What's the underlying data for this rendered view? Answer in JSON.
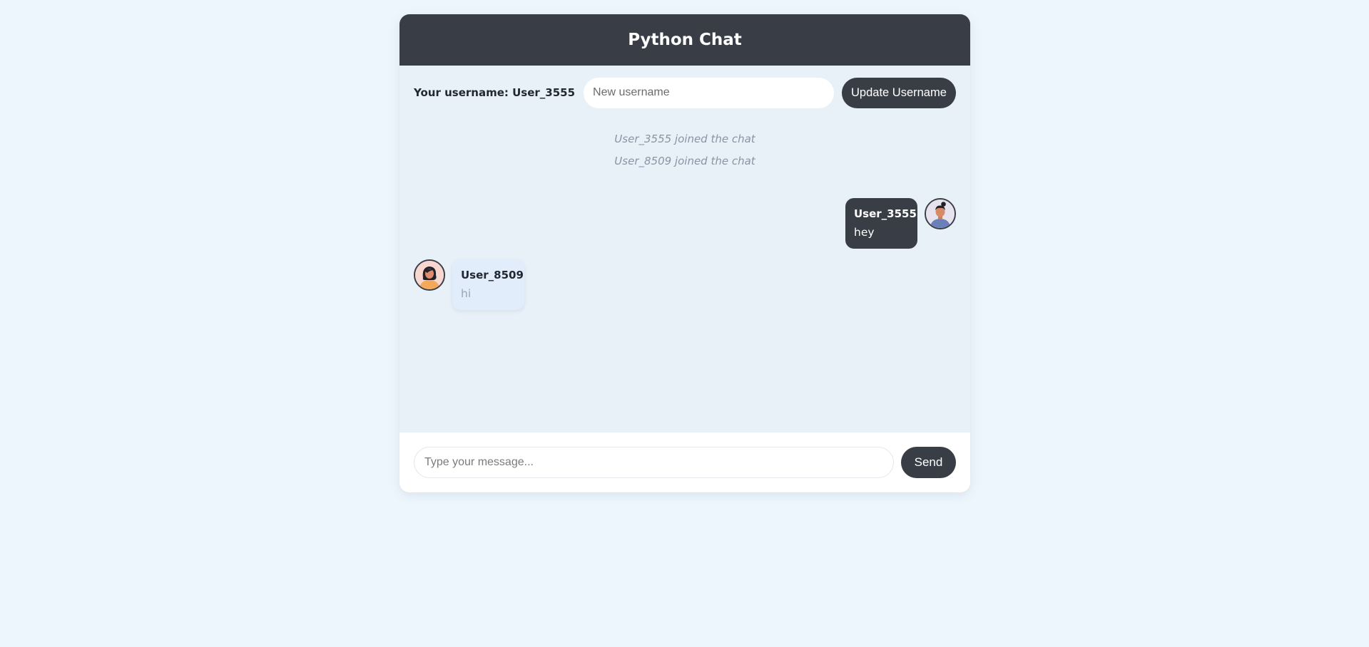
{
  "header": {
    "title": "Python Chat"
  },
  "username_bar": {
    "label": "Your username: User_3555",
    "input_placeholder": "New username",
    "input_value": "",
    "update_button": "Update Username"
  },
  "system_messages": [
    "User_3555 joined the chat",
    "User_8509 joined the chat"
  ],
  "messages": [
    {
      "user": "User_3555",
      "text": "hey",
      "direction": "outgoing",
      "avatar": "man-avatar-icon"
    },
    {
      "user": "User_8509",
      "text": "hi",
      "direction": "incoming",
      "avatar": "woman-avatar-icon"
    }
  ],
  "composer": {
    "placeholder": "Type your message...",
    "input_value": "",
    "send_button": "Send"
  },
  "colors": {
    "page_background": "#eef6fd",
    "dark": "#393e46",
    "chat_background": "#e8f0f8",
    "incoming_bubble": "#e2edfb"
  }
}
